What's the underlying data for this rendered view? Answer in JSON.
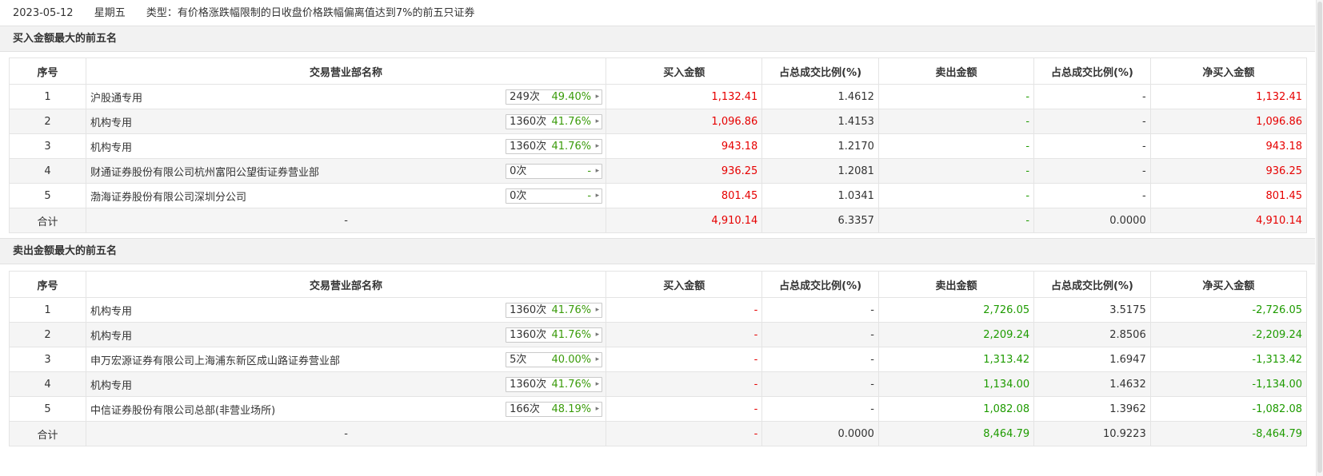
{
  "header": {
    "date": "2023-05-12",
    "weekday": "星期五",
    "type_text": "类型：有价格涨跌幅限制的日收盘价格跌幅偏离值达到7%的前五只证券"
  },
  "columns": [
    "序号",
    "交易营业部名称",
    "买入金额",
    "占总成交比例(%)",
    "卖出金额",
    "占总成交比例(%)",
    "净买入金额"
  ],
  "buy_section": {
    "title": "买入金额最大的前五名",
    "rows": [
      {
        "idx": "1",
        "name": "沪股通专用",
        "count": "249次",
        "pct": "49.40%",
        "buy": "1,132.41",
        "buy_ratio": "1.4612",
        "sell": "-",
        "sell_ratio": "-",
        "net": "1,132.41"
      },
      {
        "idx": "2",
        "name": "机构专用",
        "count": "1360次",
        "pct": "41.76%",
        "buy": "1,096.86",
        "buy_ratio": "1.4153",
        "sell": "-",
        "sell_ratio": "-",
        "net": "1,096.86"
      },
      {
        "idx": "3",
        "name": "机构专用",
        "count": "1360次",
        "pct": "41.76%",
        "buy": "943.18",
        "buy_ratio": "1.2170",
        "sell": "-",
        "sell_ratio": "-",
        "net": "943.18"
      },
      {
        "idx": "4",
        "name": "财通证券股份有限公司杭州富阳公望街证券营业部",
        "count": "0次",
        "pct": "-",
        "buy": "936.25",
        "buy_ratio": "1.2081",
        "sell": "-",
        "sell_ratio": "-",
        "net": "936.25"
      },
      {
        "idx": "5",
        "name": "渤海证券股份有限公司深圳分公司",
        "count": "0次",
        "pct": "-",
        "buy": "801.45",
        "buy_ratio": "1.0341",
        "sell": "-",
        "sell_ratio": "-",
        "net": "801.45"
      }
    ],
    "total": {
      "label": "合计",
      "name": "-",
      "buy": "4,910.14",
      "buy_ratio": "6.3357",
      "sell": "-",
      "sell_ratio": "0.0000",
      "net": "4,910.14"
    }
  },
  "sell_section": {
    "title": "卖出金额最大的前五名",
    "rows": [
      {
        "idx": "1",
        "name": "机构专用",
        "count": "1360次",
        "pct": "41.76%",
        "buy": "-",
        "buy_ratio": "-",
        "sell": "2,726.05",
        "sell_ratio": "3.5175",
        "net": "-2,726.05"
      },
      {
        "idx": "2",
        "name": "机构专用",
        "count": "1360次",
        "pct": "41.76%",
        "buy": "-",
        "buy_ratio": "-",
        "sell": "2,209.24",
        "sell_ratio": "2.8506",
        "net": "-2,209.24"
      },
      {
        "idx": "3",
        "name": "申万宏源证券有限公司上海浦东新区成山路证券营业部",
        "count": "5次",
        "pct": "40.00%",
        "buy": "-",
        "buy_ratio": "-",
        "sell": "1,313.42",
        "sell_ratio": "1.6947",
        "net": "-1,313.42"
      },
      {
        "idx": "4",
        "name": "机构专用",
        "count": "1360次",
        "pct": "41.76%",
        "buy": "-",
        "buy_ratio": "-",
        "sell": "1,134.00",
        "sell_ratio": "1.4632",
        "net": "-1,134.00"
      },
      {
        "idx": "5",
        "name": "中信证券股份有限公司总部(非营业场所)",
        "count": "166次",
        "pct": "48.19%",
        "buy": "-",
        "buy_ratio": "-",
        "sell": "1,082.08",
        "sell_ratio": "1.3962",
        "net": "-1,082.08"
      }
    ],
    "total": {
      "label": "合计",
      "name": "-",
      "buy": "-",
      "buy_ratio": "0.0000",
      "sell": "8,464.79",
      "sell_ratio": "10.9223",
      "net": "-8,464.79"
    }
  },
  "colors": {
    "up": "#e60000",
    "down": "#1e9b00",
    "stat_pct": "#3a9b0a"
  }
}
